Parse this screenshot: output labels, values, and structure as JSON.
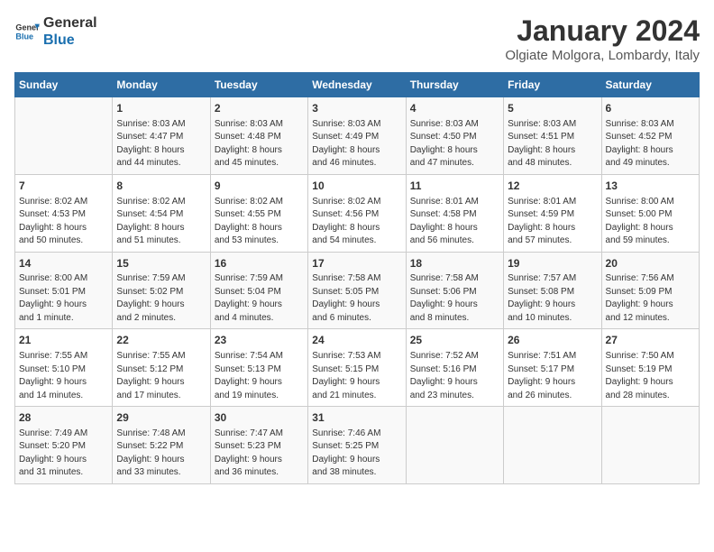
{
  "logo": {
    "line1": "General",
    "line2": "Blue"
  },
  "title": "January 2024",
  "subtitle": "Olgiate Molgora, Lombardy, Italy",
  "days_of_week": [
    "Sunday",
    "Monday",
    "Tuesday",
    "Wednesday",
    "Thursday",
    "Friday",
    "Saturday"
  ],
  "weeks": [
    [
      {
        "day": "",
        "info": ""
      },
      {
        "day": "1",
        "info": "Sunrise: 8:03 AM\nSunset: 4:47 PM\nDaylight: 8 hours\nand 44 minutes."
      },
      {
        "day": "2",
        "info": "Sunrise: 8:03 AM\nSunset: 4:48 PM\nDaylight: 8 hours\nand 45 minutes."
      },
      {
        "day": "3",
        "info": "Sunrise: 8:03 AM\nSunset: 4:49 PM\nDaylight: 8 hours\nand 46 minutes."
      },
      {
        "day": "4",
        "info": "Sunrise: 8:03 AM\nSunset: 4:50 PM\nDaylight: 8 hours\nand 47 minutes."
      },
      {
        "day": "5",
        "info": "Sunrise: 8:03 AM\nSunset: 4:51 PM\nDaylight: 8 hours\nand 48 minutes."
      },
      {
        "day": "6",
        "info": "Sunrise: 8:03 AM\nSunset: 4:52 PM\nDaylight: 8 hours\nand 49 minutes."
      }
    ],
    [
      {
        "day": "7",
        "info": "Sunrise: 8:02 AM\nSunset: 4:53 PM\nDaylight: 8 hours\nand 50 minutes."
      },
      {
        "day": "8",
        "info": "Sunrise: 8:02 AM\nSunset: 4:54 PM\nDaylight: 8 hours\nand 51 minutes."
      },
      {
        "day": "9",
        "info": "Sunrise: 8:02 AM\nSunset: 4:55 PM\nDaylight: 8 hours\nand 53 minutes."
      },
      {
        "day": "10",
        "info": "Sunrise: 8:02 AM\nSunset: 4:56 PM\nDaylight: 8 hours\nand 54 minutes."
      },
      {
        "day": "11",
        "info": "Sunrise: 8:01 AM\nSunset: 4:58 PM\nDaylight: 8 hours\nand 56 minutes."
      },
      {
        "day": "12",
        "info": "Sunrise: 8:01 AM\nSunset: 4:59 PM\nDaylight: 8 hours\nand 57 minutes."
      },
      {
        "day": "13",
        "info": "Sunrise: 8:00 AM\nSunset: 5:00 PM\nDaylight: 8 hours\nand 59 minutes."
      }
    ],
    [
      {
        "day": "14",
        "info": "Sunrise: 8:00 AM\nSunset: 5:01 PM\nDaylight: 9 hours\nand 1 minute."
      },
      {
        "day": "15",
        "info": "Sunrise: 7:59 AM\nSunset: 5:02 PM\nDaylight: 9 hours\nand 2 minutes."
      },
      {
        "day": "16",
        "info": "Sunrise: 7:59 AM\nSunset: 5:04 PM\nDaylight: 9 hours\nand 4 minutes."
      },
      {
        "day": "17",
        "info": "Sunrise: 7:58 AM\nSunset: 5:05 PM\nDaylight: 9 hours\nand 6 minutes."
      },
      {
        "day": "18",
        "info": "Sunrise: 7:58 AM\nSunset: 5:06 PM\nDaylight: 9 hours\nand 8 minutes."
      },
      {
        "day": "19",
        "info": "Sunrise: 7:57 AM\nSunset: 5:08 PM\nDaylight: 9 hours\nand 10 minutes."
      },
      {
        "day": "20",
        "info": "Sunrise: 7:56 AM\nSunset: 5:09 PM\nDaylight: 9 hours\nand 12 minutes."
      }
    ],
    [
      {
        "day": "21",
        "info": "Sunrise: 7:55 AM\nSunset: 5:10 PM\nDaylight: 9 hours\nand 14 minutes."
      },
      {
        "day": "22",
        "info": "Sunrise: 7:55 AM\nSunset: 5:12 PM\nDaylight: 9 hours\nand 17 minutes."
      },
      {
        "day": "23",
        "info": "Sunrise: 7:54 AM\nSunset: 5:13 PM\nDaylight: 9 hours\nand 19 minutes."
      },
      {
        "day": "24",
        "info": "Sunrise: 7:53 AM\nSunset: 5:15 PM\nDaylight: 9 hours\nand 21 minutes."
      },
      {
        "day": "25",
        "info": "Sunrise: 7:52 AM\nSunset: 5:16 PM\nDaylight: 9 hours\nand 23 minutes."
      },
      {
        "day": "26",
        "info": "Sunrise: 7:51 AM\nSunset: 5:17 PM\nDaylight: 9 hours\nand 26 minutes."
      },
      {
        "day": "27",
        "info": "Sunrise: 7:50 AM\nSunset: 5:19 PM\nDaylight: 9 hours\nand 28 minutes."
      }
    ],
    [
      {
        "day": "28",
        "info": "Sunrise: 7:49 AM\nSunset: 5:20 PM\nDaylight: 9 hours\nand 31 minutes."
      },
      {
        "day": "29",
        "info": "Sunrise: 7:48 AM\nSunset: 5:22 PM\nDaylight: 9 hours\nand 33 minutes."
      },
      {
        "day": "30",
        "info": "Sunrise: 7:47 AM\nSunset: 5:23 PM\nDaylight: 9 hours\nand 36 minutes."
      },
      {
        "day": "31",
        "info": "Sunrise: 7:46 AM\nSunset: 5:25 PM\nDaylight: 9 hours\nand 38 minutes."
      },
      {
        "day": "",
        "info": ""
      },
      {
        "day": "",
        "info": ""
      },
      {
        "day": "",
        "info": ""
      }
    ]
  ]
}
